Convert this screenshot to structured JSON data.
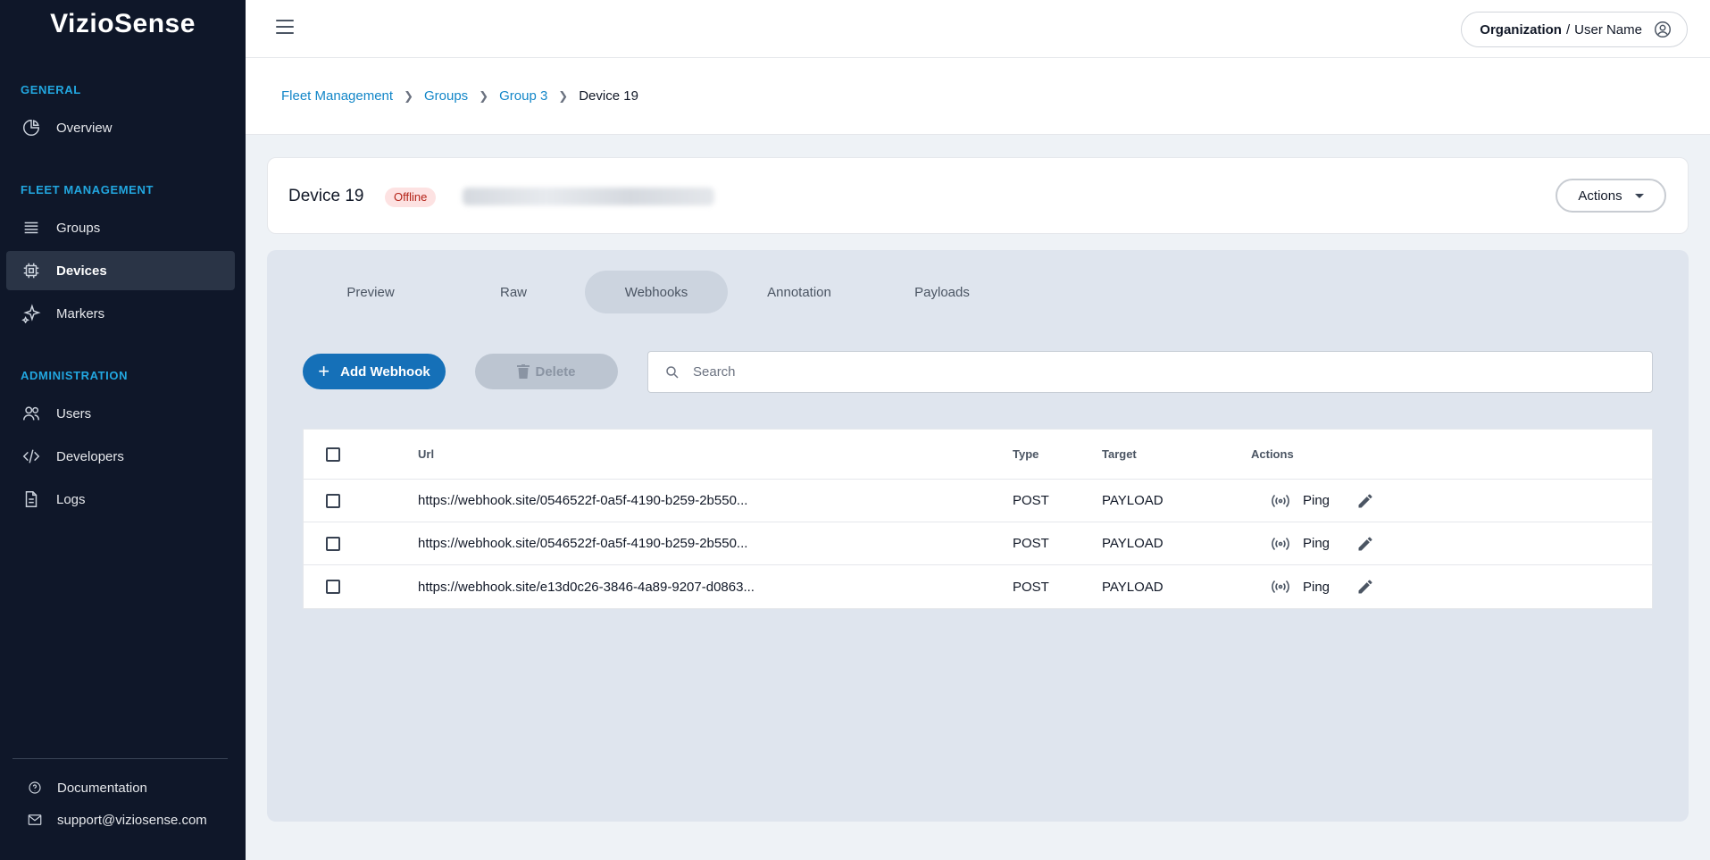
{
  "app": {
    "logo": "VizioSense"
  },
  "sidebar": {
    "general_label": "GENERAL",
    "fleet_label": "FLEET MANAGEMENT",
    "admin_label": "ADMINISTRATION",
    "items": [
      {
        "label": "Overview",
        "icon": "pie-chart-icon"
      },
      {
        "label": "Groups",
        "icon": "list-icon"
      },
      {
        "label": "Devices",
        "icon": "chip-icon",
        "active": true
      },
      {
        "label": "Markers",
        "icon": "sparkle-icon"
      },
      {
        "label": "Users",
        "icon": "users-icon"
      },
      {
        "label": "Developers",
        "icon": "code-icon"
      },
      {
        "label": "Logs",
        "icon": "document-icon"
      }
    ],
    "footer": {
      "documentation": "Documentation",
      "support": "support@viziosense.com"
    }
  },
  "topbar": {
    "org": "Organization",
    "separator": "/",
    "user": "User Name"
  },
  "breadcrumb": {
    "items": [
      "Fleet Management",
      "Groups",
      "Group 3"
    ],
    "current": "Device 19"
  },
  "device": {
    "title": "Device 19",
    "status": "Offline",
    "actions_label": "Actions"
  },
  "tabs": [
    "Preview",
    "Raw",
    "Webhooks",
    "Annotation",
    "Payloads"
  ],
  "active_tab": "Webhooks",
  "toolbar": {
    "add_label": "Add Webhook",
    "delete_label": "Delete",
    "search_placeholder": "Search"
  },
  "table": {
    "columns": [
      "Url",
      "Type",
      "Target",
      "Actions"
    ],
    "ping_label": "Ping",
    "rows": [
      {
        "url": "https://webhook.site/0546522f-0a5f-4190-b259-2b550...",
        "type": "POST",
        "target": "PAYLOAD"
      },
      {
        "url": "https://webhook.site/0546522f-0a5f-4190-b259-2b550...",
        "type": "POST",
        "target": "PAYLOAD"
      },
      {
        "url": "https://webhook.site/e13d0c26-3846-4a89-9207-d0863...",
        "type": "POST",
        "target": "PAYLOAD"
      }
    ]
  },
  "colors": {
    "sidebar_bg": "#0f1729",
    "accent": "#22a7e0",
    "primary_button": "#1570b8",
    "link": "#1286c8",
    "offline_badge_bg": "#fde2e2",
    "offline_badge_text": "#b42318"
  }
}
